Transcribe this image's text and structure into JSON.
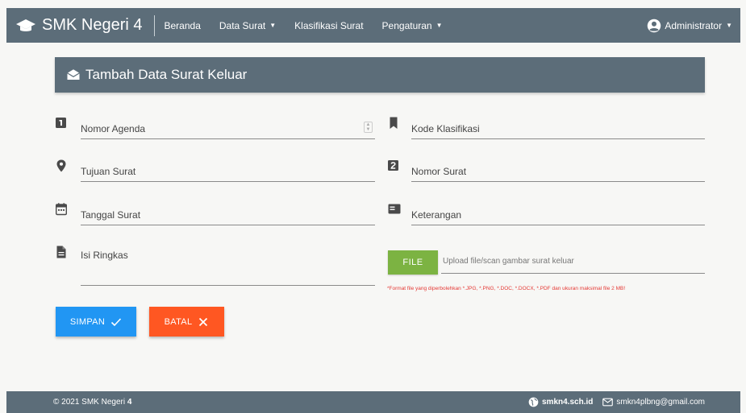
{
  "navbar": {
    "brand": "SMK Negeri 4",
    "items": [
      {
        "label": "Beranda"
      },
      {
        "label": "Data Surat"
      },
      {
        "label": "Klasifikasi Surat"
      },
      {
        "label": "Pengaturan"
      }
    ],
    "user": "Administrator"
  },
  "card": {
    "title": "Tambah Data Surat Keluar"
  },
  "form": {
    "nomor_agenda": "Nomor Agenda",
    "kode_klasifikasi": "Kode Klasifikasi",
    "tujuan_surat": "Tujuan Surat",
    "nomor_surat": "Nomor Surat",
    "tanggal_surat": "Tanggal Surat",
    "keterangan": "Keterangan",
    "isi_ringkas": "Isi Ringkas"
  },
  "file": {
    "button_label": "FILE",
    "placeholder": "Upload file/scan gambar surat keluar",
    "note": "*Format file yang diperbolehkan *.JPG, *.PNG, *.DOC, *.DOCX, *.PDF dan ukuran maksimal file 2 MB!"
  },
  "buttons": {
    "save": "SIMPAN",
    "cancel": "BATAL"
  },
  "footer": {
    "copyright": "© 2021 SMK Negeri ",
    "copyright_bold": "4",
    "website": "smkn4.sch.id",
    "email": "smkn4plbng@gmail.com"
  },
  "colors": {
    "primary": "#5c6d79",
    "save": "#2196f3",
    "cancel": "#ff5722",
    "file": "#7cb342",
    "note": "#e53935"
  }
}
